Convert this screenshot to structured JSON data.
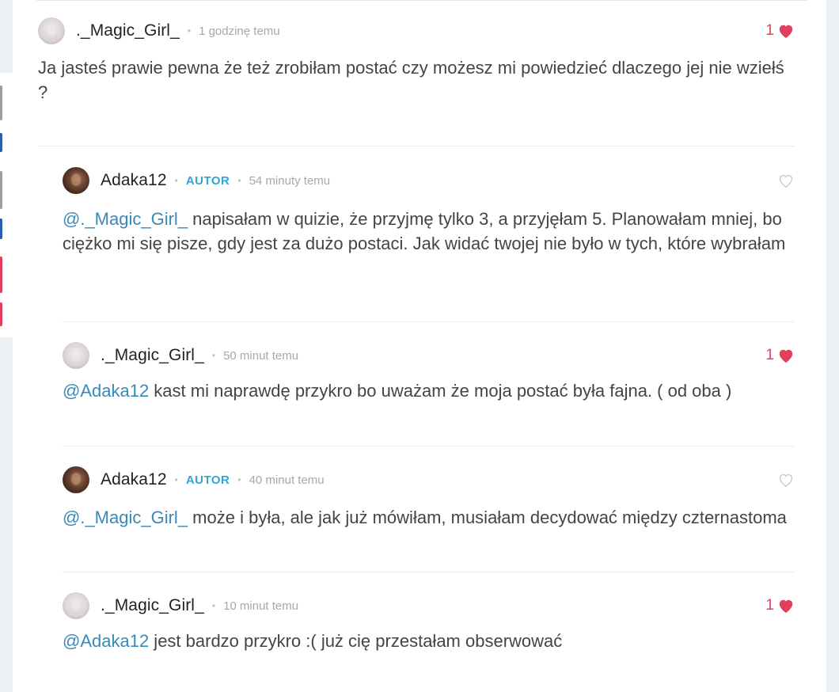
{
  "comments": [
    {
      "username": "._Magic_Girl_",
      "badge": "",
      "time": "1 godzinę temu",
      "likes": "1",
      "liked": true,
      "mention": "",
      "text": "Ja jasteś prawie pewna że też zrobiłam postać czy możesz mi powiedzieć dlaczego jej nie wziełś ?"
    },
    {
      "username": "Adaka12",
      "badge": "AUTOR",
      "time": "54 minuty temu",
      "likes": "",
      "liked": false,
      "mention": "@._Magic_Girl_",
      "text": " napisałam w quizie, że przyjmę tylko 3, a przyjęłam 5. Planowałam mniej, bo ciężko mi się pisze, gdy jest za dużo postaci. Jak widać twojej nie było w tych, które wybrałam"
    },
    {
      "username": "._Magic_Girl_",
      "badge": "",
      "time": "50 minut temu",
      "likes": "1",
      "liked": true,
      "mention": "@Adaka12",
      "text": " kast mi naprawdę przykro bo uważam że moja postać była fajna. ( od oba )"
    },
    {
      "username": "Adaka12",
      "badge": "AUTOR",
      "time": "40 minut temu",
      "likes": "",
      "liked": false,
      "mention": "@._Magic_Girl_",
      "text": " może i była, ale jak już mówiłam, musiałam decydować między czternastoma"
    },
    {
      "username": "._Magic_Girl_",
      "badge": "",
      "time": "10 minut temu",
      "likes": "1",
      "liked": true,
      "mention": "@Adaka12",
      "text": " jest bardzo przykro :( już cię przestałam obserwować"
    }
  ],
  "separator": "•",
  "colors": {
    "accent_heart": "#e0405e",
    "mention": "#3a89b8",
    "badge": "#2fa5d6",
    "side_marks": [
      "#9aa0a6",
      "#2b5ea8",
      "#9aa0a6",
      "#2b5ea8",
      "#e0405e",
      "#e0405e"
    ]
  }
}
